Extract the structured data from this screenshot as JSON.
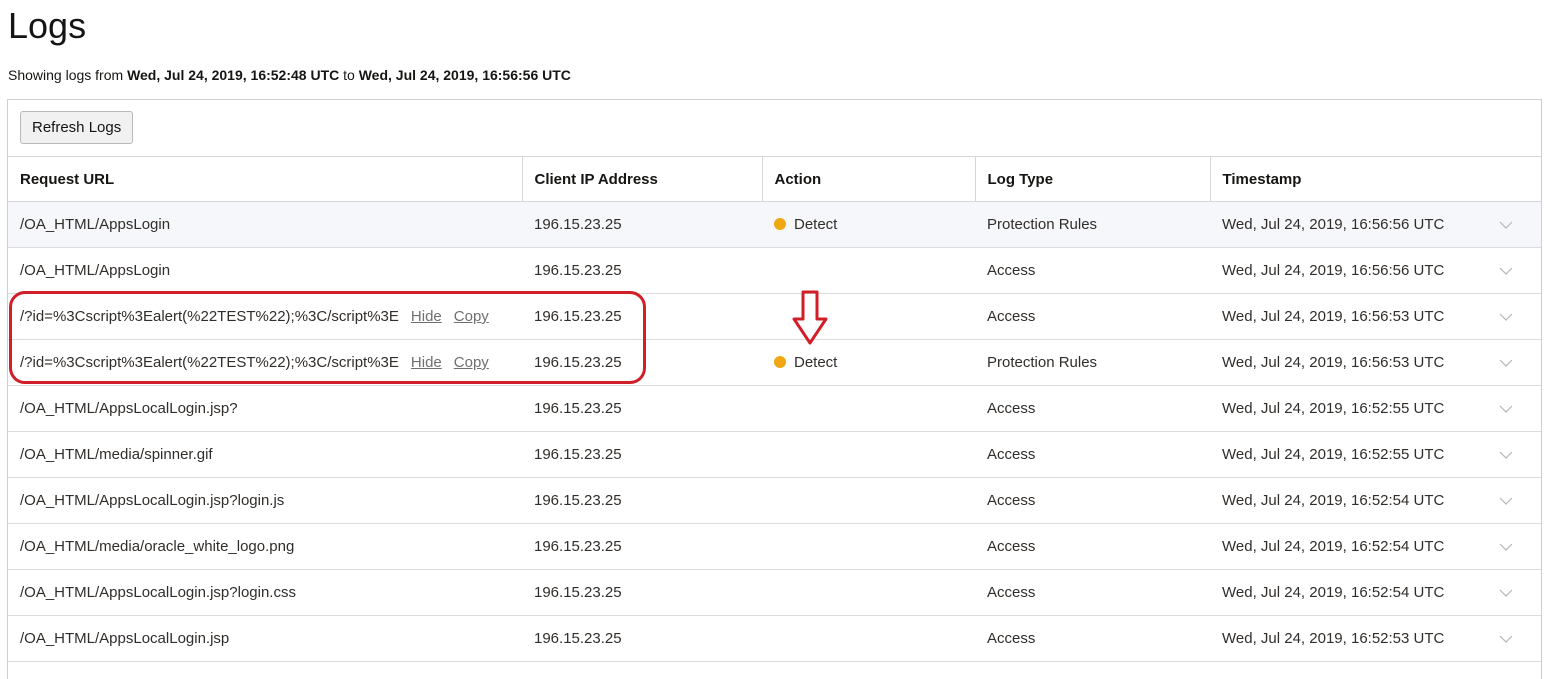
{
  "page": {
    "title": "Logs",
    "range_prefix": "Showing logs from",
    "range_start": "Wed, Jul 24, 2019, 16:52:48 UTC",
    "range_mid": "to",
    "range_end": "Wed, Jul 24, 2019, 16:56:56 UTC"
  },
  "toolbar": {
    "refresh_label": "Refresh Logs"
  },
  "table": {
    "columns": [
      "Request URL",
      "Client IP Address",
      "Action",
      "Log Type",
      "Timestamp"
    ],
    "hide_label": "Hide",
    "copy_label": "Copy",
    "rows": [
      {
        "url": "/OA_HTML/AppsLogin",
        "ip": "196.15.23.25",
        "action": "Detect",
        "log_type": "Protection Rules",
        "timestamp": "Wed, Jul 24, 2019, 16:56:56 UTC"
      },
      {
        "url": "/OA_HTML/AppsLogin",
        "ip": "196.15.23.25",
        "action": "",
        "log_type": "Access",
        "timestamp": "Wed, Jul 24, 2019, 16:56:56 UTC"
      },
      {
        "url": "/?id=%3Cscript%3Ealert(%22TEST%22);%3C/script%3E",
        "ip": "196.15.23.25",
        "action": "",
        "log_type": "Access",
        "timestamp": "Wed, Jul 24, 2019, 16:56:53 UTC"
      },
      {
        "url": "/?id=%3Cscript%3Ealert(%22TEST%22);%3C/script%3E",
        "ip": "196.15.23.25",
        "action": "Detect",
        "log_type": "Protection Rules",
        "timestamp": "Wed, Jul 24, 2019, 16:56:53 UTC"
      },
      {
        "url": "/OA_HTML/AppsLocalLogin.jsp?",
        "ip": "196.15.23.25",
        "action": "",
        "log_type": "Access",
        "timestamp": "Wed, Jul 24, 2019, 16:52:55 UTC"
      },
      {
        "url": "/OA_HTML/media/spinner.gif",
        "ip": "196.15.23.25",
        "action": "",
        "log_type": "Access",
        "timestamp": "Wed, Jul 24, 2019, 16:52:55 UTC"
      },
      {
        "url": "/OA_HTML/AppsLocalLogin.jsp?login.js",
        "ip": "196.15.23.25",
        "action": "",
        "log_type": "Access",
        "timestamp": "Wed, Jul 24, 2019, 16:52:54 UTC"
      },
      {
        "url": "/OA_HTML/media/oracle_white_logo.png",
        "ip": "196.15.23.25",
        "action": "",
        "log_type": "Access",
        "timestamp": "Wed, Jul 24, 2019, 16:52:54 UTC"
      },
      {
        "url": "/OA_HTML/AppsLocalLogin.jsp?login.css",
        "ip": "196.15.23.25",
        "action": "",
        "log_type": "Access",
        "timestamp": "Wed, Jul 24, 2019, 16:52:54 UTC"
      },
      {
        "url": "/OA_HTML/AppsLocalLogin.jsp",
        "ip": "196.15.23.25",
        "action": "",
        "log_type": "Access",
        "timestamp": "Wed, Jul 24, 2019, 16:52:53 UTC"
      }
    ]
  },
  "colors": {
    "detect_dot": "#f0a812",
    "highlight": "#d11f2a"
  },
  "icons": {
    "expand": "chevron-down-icon",
    "action": "status-dot-icon",
    "annotation": "down-arrow-icon"
  }
}
